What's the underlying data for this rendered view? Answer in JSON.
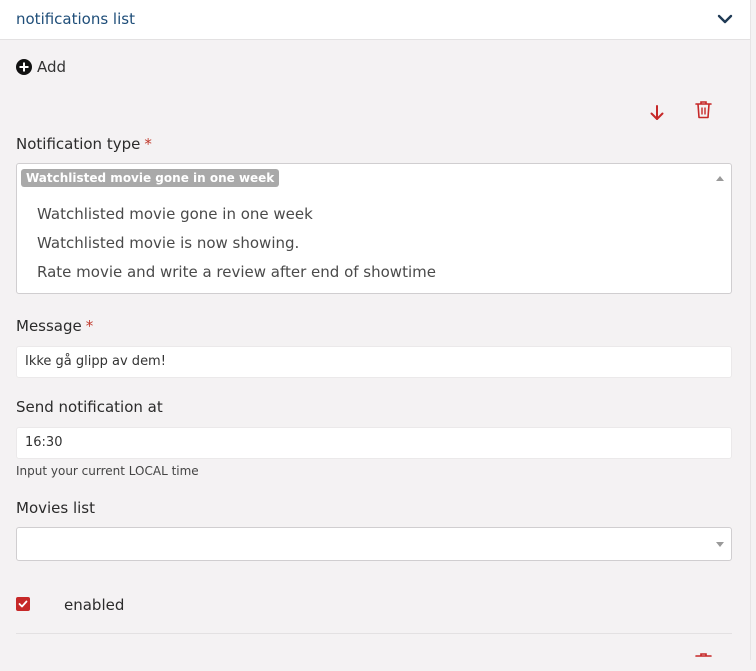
{
  "header": {
    "title": "notifications list",
    "toggle_icon": "chevron-down-icon"
  },
  "add": {
    "label": "Add",
    "icon": "plus-circle-icon"
  },
  "item_actions": {
    "move_icon": "arrow-down-icon",
    "delete_icon": "trash-icon"
  },
  "notification_type": {
    "label": "Notification type",
    "required_mark": "*",
    "selected": "Watchlisted movie gone in one week",
    "options": [
      "Watchlisted movie gone in one week",
      "Watchlisted movie is now showing.",
      "Rate movie and write a review after end of showtime"
    ]
  },
  "message": {
    "label": "Message",
    "required_mark": "*",
    "value": "Ikke gå glipp av dem!"
  },
  "send_at": {
    "label": "Send notification at",
    "value": "16:30",
    "help": "Input your current LOCAL time"
  },
  "movies_list": {
    "label": "Movies list",
    "value": ""
  },
  "enabled": {
    "label": "enabled",
    "checked": true
  },
  "colors": {
    "accent": "#c62828",
    "title": "#1f4e79",
    "background": "#f4f2f3"
  }
}
